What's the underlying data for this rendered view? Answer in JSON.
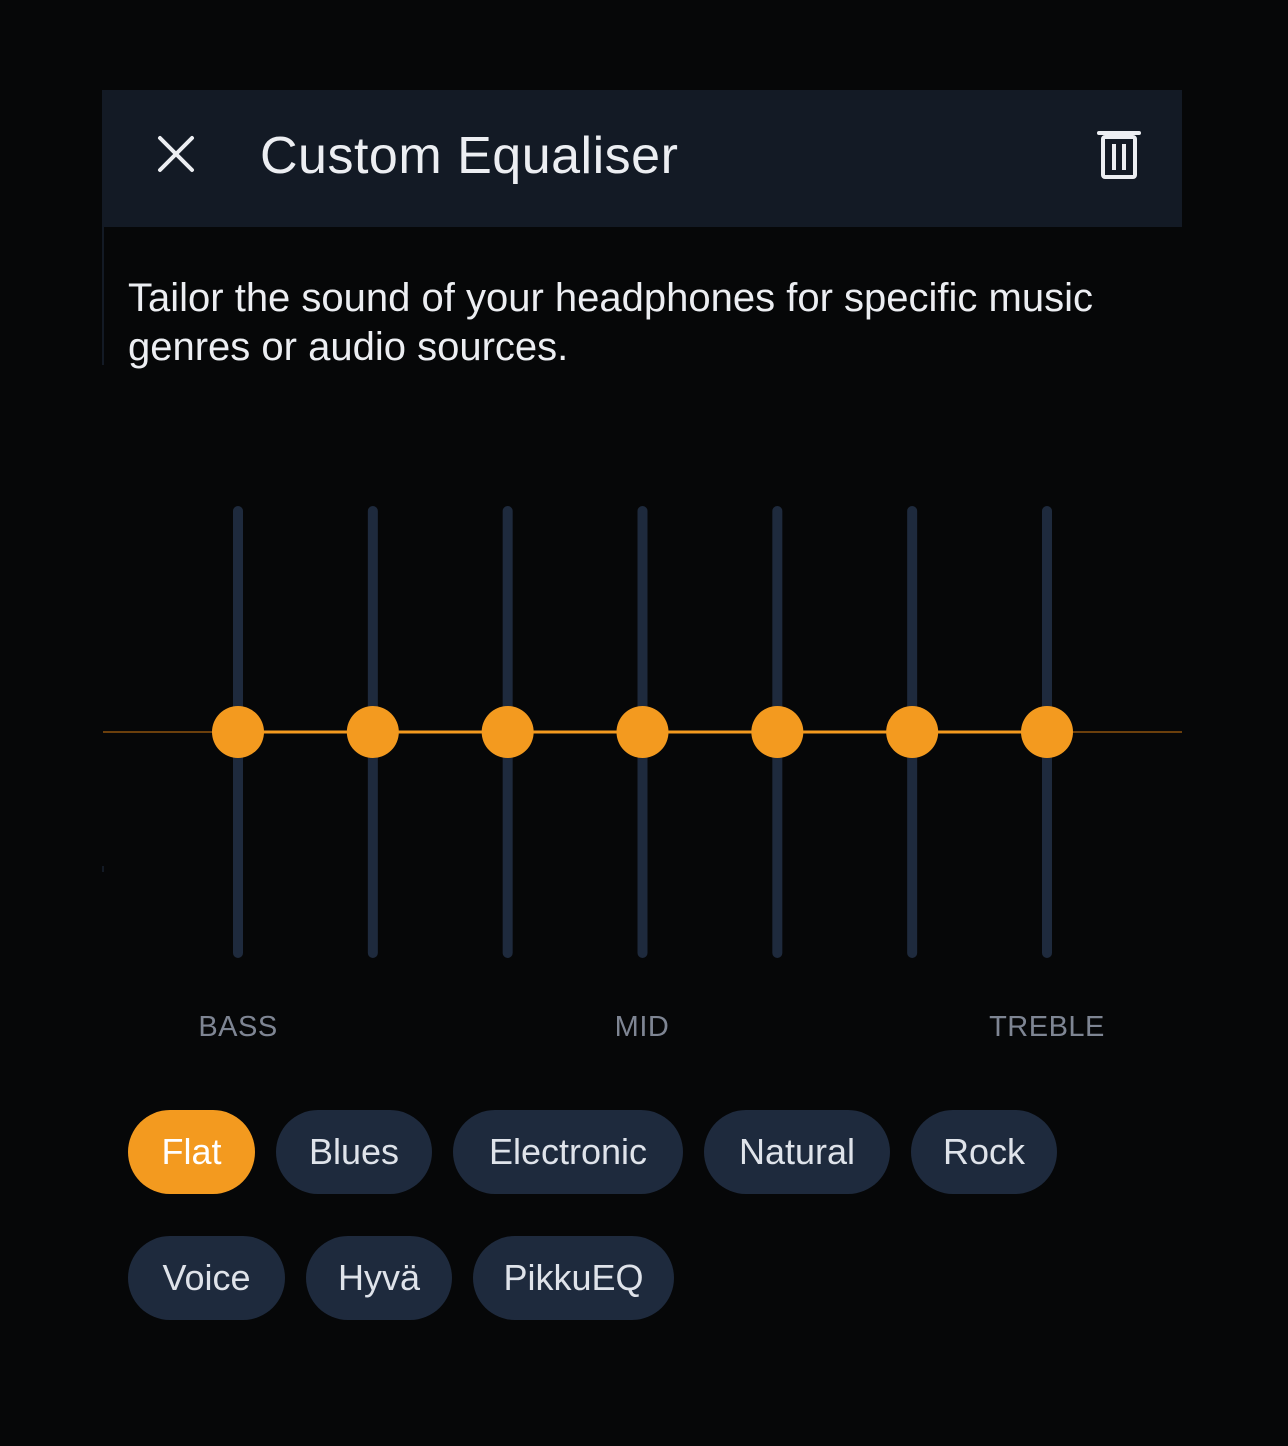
{
  "header": {
    "title": "Custom Equaliser",
    "close_icon": "close-icon",
    "delete_icon": "trash-icon"
  },
  "description": "Tailor the sound of your headphones for specific music genres or audio sources.",
  "equaliser": {
    "band_count": 7,
    "band_levels": [
      0,
      0,
      0,
      0,
      0,
      0,
      0
    ],
    "band_labels": {
      "bass": "BASS",
      "mid": "MID",
      "treble": "TREBLE"
    }
  },
  "presets": [
    {
      "label": "Flat",
      "selected": true
    },
    {
      "label": "Blues",
      "selected": false
    },
    {
      "label": "Electronic",
      "selected": false
    },
    {
      "label": "Natural",
      "selected": false
    },
    {
      "label": "Rock",
      "selected": false
    },
    {
      "label": "Voice",
      "selected": false
    },
    {
      "label": "Hyvä",
      "selected": false
    },
    {
      "label": "PikkuEQ",
      "selected": false
    }
  ],
  "colors": {
    "accent": "#f39a1f",
    "track": "#1e2a3d",
    "background": "#060708",
    "header": "#131a25"
  }
}
